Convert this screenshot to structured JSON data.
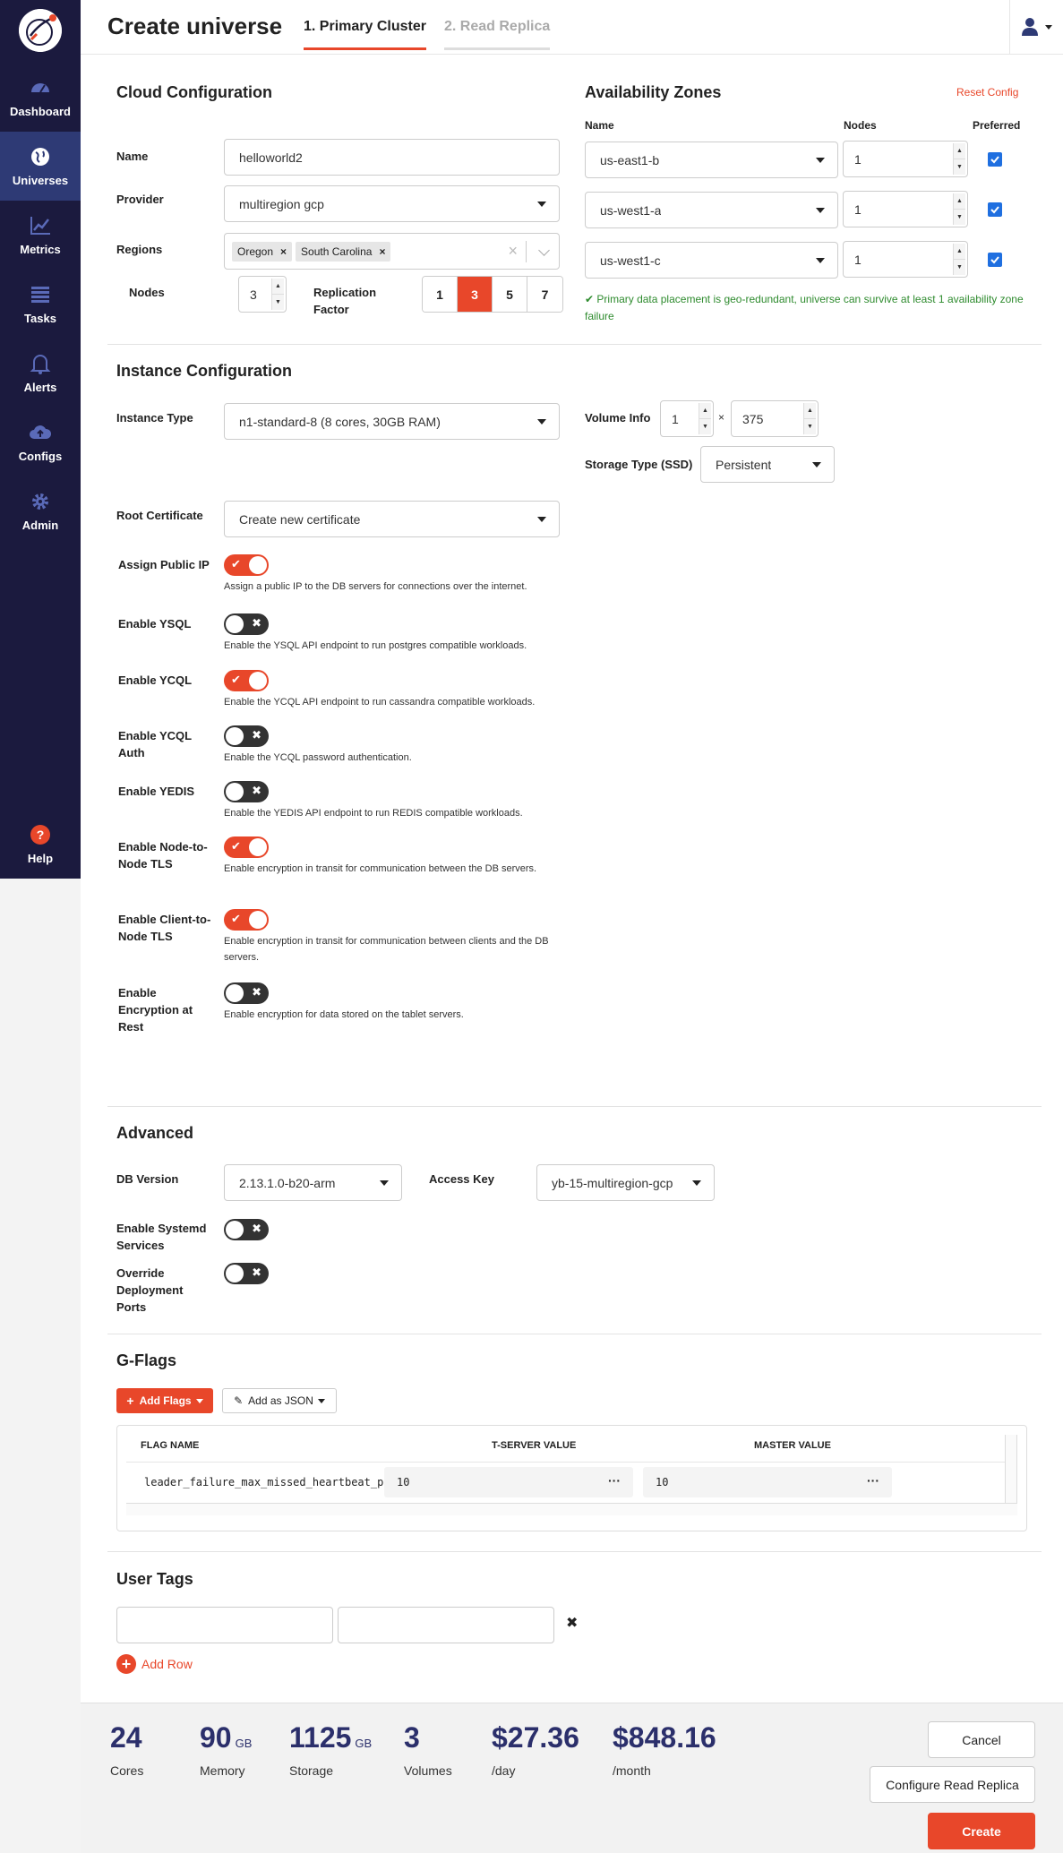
{
  "sidebar": {
    "items": [
      {
        "label": "Dashboard",
        "icon": "dashboard-icon"
      },
      {
        "label": "Universes",
        "icon": "globe-icon",
        "active": true
      },
      {
        "label": "Metrics",
        "icon": "chart-icon"
      },
      {
        "label": "Tasks",
        "icon": "list-icon"
      },
      {
        "label": "Alerts",
        "icon": "bell-icon"
      },
      {
        "label": "Configs",
        "icon": "cloud-upload-icon"
      },
      {
        "label": "Admin",
        "icon": "gear-icon"
      },
      {
        "label": "Help",
        "icon": "help-icon"
      }
    ]
  },
  "header": {
    "title": "Create universe",
    "tabs": [
      "1. Primary Cluster",
      "2. Read Replica"
    ]
  },
  "cloud": {
    "title": "Cloud Configuration",
    "name_label": "Name",
    "name_value": "helloworld2",
    "provider_label": "Provider",
    "provider_value": "multiregion gcp",
    "regions_label": "Regions",
    "regions": [
      "Oregon",
      "South Carolina"
    ],
    "nodes_label": "Nodes",
    "nodes_value": "3",
    "rf_label": "Replication Factor",
    "rf_options": [
      "1",
      "3",
      "5",
      "7"
    ],
    "rf_selected": "3"
  },
  "az": {
    "title": "Availability Zones",
    "reset": "Reset Config",
    "col_name": "Name",
    "col_nodes": "Nodes",
    "col_preferred": "Preferred",
    "rows": [
      {
        "zone": "us-east1-b",
        "nodes": "1"
      },
      {
        "zone": "us-west1-a",
        "nodes": "1"
      },
      {
        "zone": "us-west1-c",
        "nodes": "1"
      }
    ],
    "status": "Primary data placement is geo-redundant, universe can survive at least 1 availability zone failure",
    "status_color": "#2e8b2e"
  },
  "instance": {
    "title": "Instance Configuration",
    "type_label": "Instance Type",
    "type_value": "n1-standard-8 (8 cores, 30GB RAM)",
    "volume_label": "Volume Info",
    "volume_count": "1",
    "volume_x": "×",
    "volume_size": "375",
    "storage_label": "Storage Type (SSD)",
    "storage_value": "Persistent",
    "cert_label": "Root Certificate",
    "cert_value": "Create new certificate",
    "toggles": [
      {
        "label": "Assign Public IP",
        "on": true,
        "hint": "Assign a public IP to the DB servers for connections over the internet."
      },
      {
        "label": "Enable YSQL",
        "on": false,
        "hint": "Enable the YSQL API endpoint to run postgres compatible workloads."
      },
      {
        "label": "Enable YCQL",
        "on": true,
        "hint": "Enable the YCQL API endpoint to run cassandra compatible workloads."
      },
      {
        "label": "Enable YCQL Auth",
        "on": false,
        "hint": "Enable the YCQL password authentication."
      },
      {
        "label": "Enable YEDIS",
        "on": false,
        "hint": "Enable the YEDIS API endpoint to run REDIS compatible workloads."
      },
      {
        "label": "Enable Node-to-Node TLS",
        "on": true,
        "hint": "Enable encryption in transit for communication between the DB servers."
      },
      {
        "label": "Enable Client-to-Node TLS",
        "on": true,
        "hint": "Enable encryption in transit for communication between clients and the DB servers."
      },
      {
        "label": "Enable Encryption at Rest",
        "on": false,
        "hint": "Enable encryption for data stored on the tablet servers."
      }
    ]
  },
  "advanced": {
    "title": "Advanced",
    "db_label": "DB Version",
    "db_value": "2.13.1.0-b20-arm",
    "key_label": "Access Key",
    "key_value": "yb-15-multiregion-gcp",
    "systemd_label": "Enable Systemd Services",
    "ports_label": "Override Deployment Ports"
  },
  "gflags": {
    "title": "G-Flags",
    "add_flags": "Add Flags",
    "add_json": "Add as JSON",
    "col_flag": "FLAG NAME",
    "col_tserver": "T-SERVER VALUE",
    "col_master": "MASTER VALUE",
    "rows": [
      {
        "flag": "leader_failure_max_missed_heartbeat_periods",
        "tserver": "10",
        "master": "10"
      }
    ]
  },
  "tags": {
    "title": "User Tags",
    "add_row": "Add Row"
  },
  "footer": {
    "stats": [
      {
        "value": "24",
        "unit": "",
        "label": "Cores"
      },
      {
        "value": "90",
        "unit": "GB",
        "label": "Memory"
      },
      {
        "value": "1125",
        "unit": "GB",
        "label": "Storage"
      },
      {
        "value": "3",
        "unit": "",
        "label": "Volumes"
      },
      {
        "value": "$27.36",
        "unit": "",
        "label": "/day"
      },
      {
        "value": "$848.16",
        "unit": "",
        "label": "/month"
      }
    ],
    "cancel": "Cancel",
    "configure_rr": "Configure Read Replica",
    "create": "Create"
  },
  "colors": {
    "accent": "#e8472a",
    "sidebar": "#1b1a3e",
    "sidebar_active": "#2e3a75",
    "stat": "#2b2f6b",
    "checkbox": "#1f6fe0"
  }
}
